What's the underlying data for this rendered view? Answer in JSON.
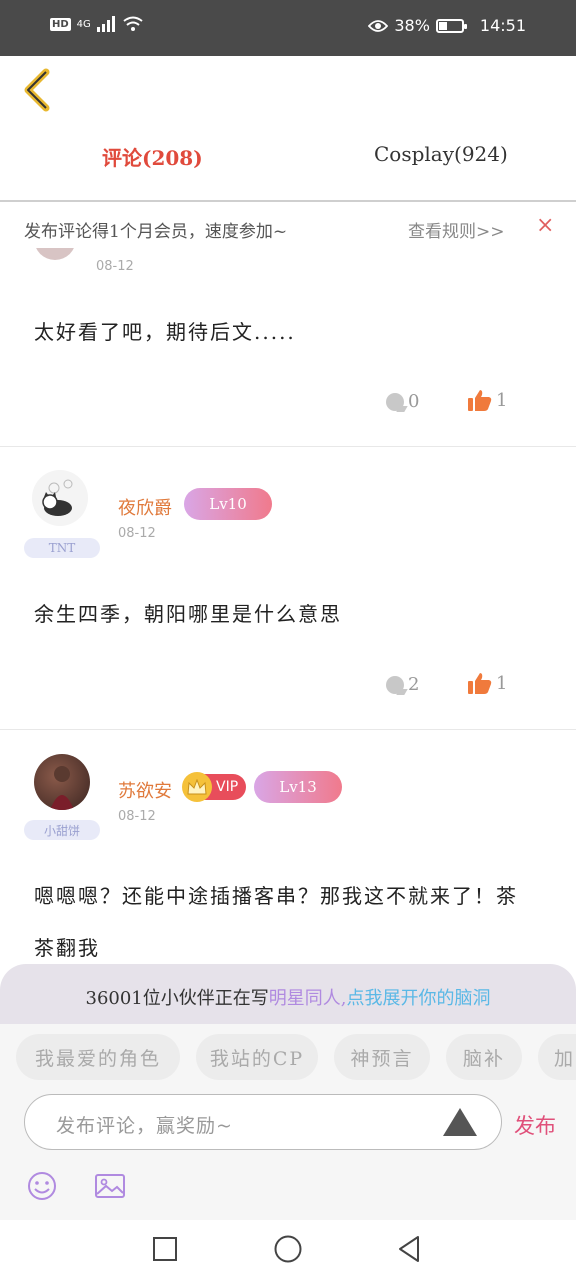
{
  "status_bar": {
    "hd": "HD",
    "network": "4G",
    "battery_percent": "38%",
    "battery_level": 0.38,
    "time": "14:51"
  },
  "tabs": [
    {
      "label": "评论(208)",
      "active": true
    },
    {
      "label": "Cosplay(924)",
      "active": false
    }
  ],
  "notice": {
    "text": "发布评论得1个月会员，速度参加~",
    "link": "查看规则>>",
    "close": "×"
  },
  "comments": [
    {
      "date": "08-12",
      "text": "太好看了吧，期待后文.....",
      "replies": "0",
      "likes": "1"
    },
    {
      "name": "夜欣爵",
      "level": "Lv10",
      "badge": "TNT",
      "date": "08-12",
      "text": "余生四季，朝阳哪里是什么意思",
      "replies": "2",
      "likes": "1"
    },
    {
      "name": "苏欲安",
      "vip": "VIP",
      "level": "Lv13",
      "badge": "小甜饼",
      "date": "08-12",
      "text_line1": "嗯嗯嗯？还能中途插播客串？那我这不就来了！茶",
      "text_line2": "茶翻我"
    }
  ],
  "banner": {
    "prefix": "36001位小伙伴正在写",
    "topic": "明星同人,",
    "cta": "点我展开你的脑洞"
  },
  "chips": [
    "我最爱的角色",
    "我站的CP",
    "神预言",
    "脑补",
    "加"
  ],
  "input": {
    "placeholder": "发布评论，赢奖励~",
    "publish": "发布"
  },
  "colors": {
    "accent_red": "#e04a3c",
    "name_orange": "#e07a3c",
    "publish_pink": "#e0507a",
    "banner_purple": "#b08ae0",
    "banner_blue": "#5ab8e6"
  }
}
